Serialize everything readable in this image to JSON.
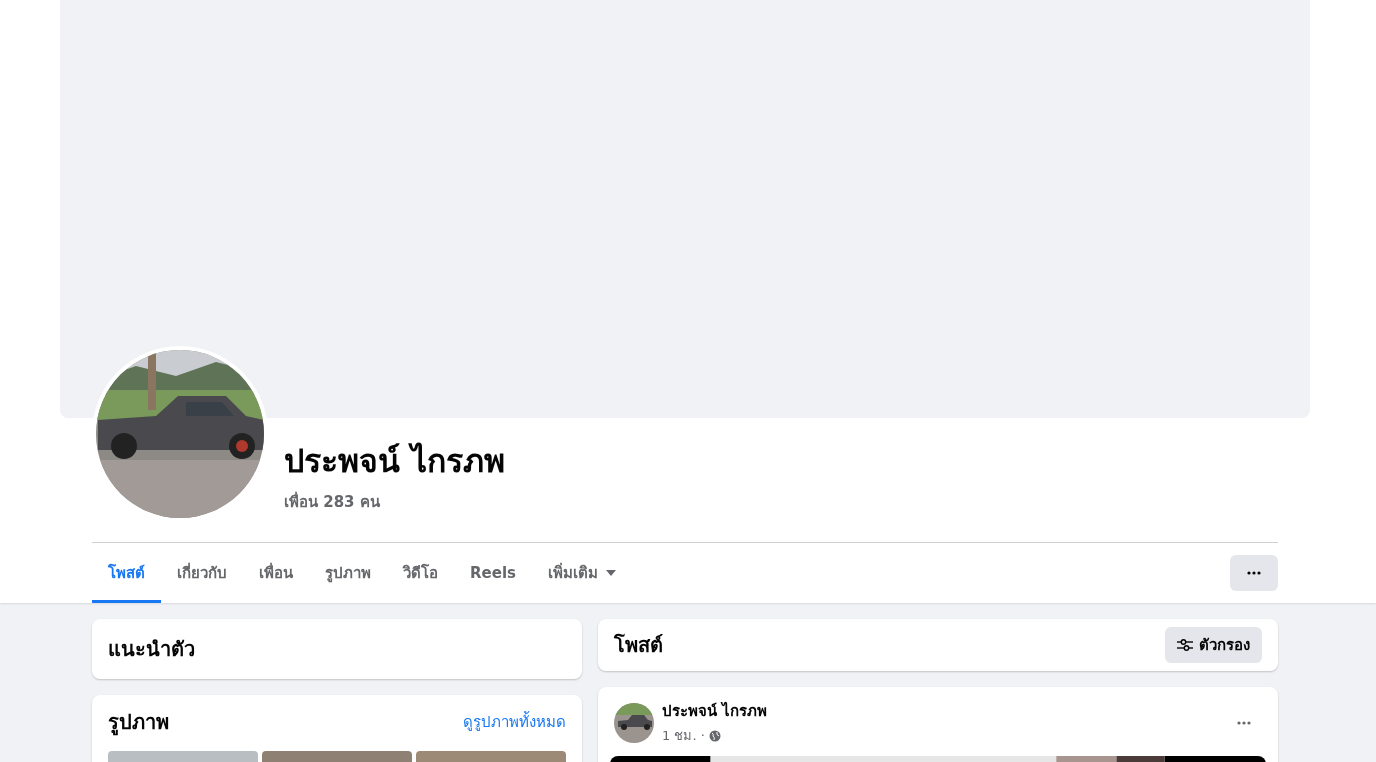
{
  "profile": {
    "name": "ประพจน์ ไกรภพ",
    "friends": "เพื่อน 283 คน"
  },
  "tabs": [
    {
      "label": "โพสต์",
      "selected": true
    },
    {
      "label": "เกี่ยวกับ",
      "selected": false
    },
    {
      "label": "เพื่อน",
      "selected": false
    },
    {
      "label": "รูปภาพ",
      "selected": false
    },
    {
      "label": "วิดีโอ",
      "selected": false
    },
    {
      "label": "Reels",
      "selected": false
    },
    {
      "label": "เพิ่มเติม",
      "selected": false,
      "kind": "dropdown"
    }
  ],
  "intro": {
    "title": "แนะนำตัว"
  },
  "photos": {
    "title": "รูปภาพ",
    "link": "ดูรูปภาพทั้งหมด"
  },
  "posts": {
    "title": "โพสต์",
    "filter": "ตัวกรอง"
  },
  "post": {
    "author": "ประพจน์ ไกรภพ",
    "time": "1 ชม. ·"
  }
}
